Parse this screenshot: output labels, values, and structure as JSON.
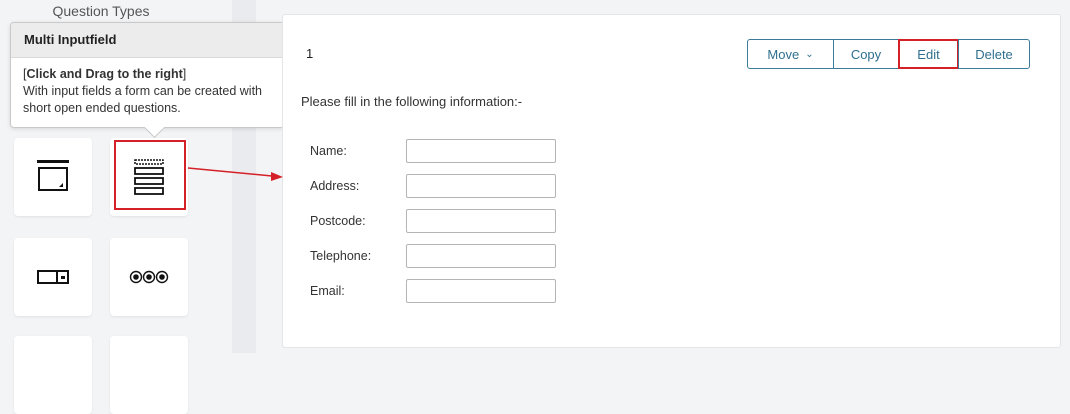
{
  "sidebar": {
    "title": "Question Types",
    "tiles": [
      {
        "icon": "single-input-icon"
      },
      {
        "icon": "multi-inputfield-icon"
      },
      {
        "icon": "dropdown-icon"
      },
      {
        "icon": "radio-buttons-icon"
      }
    ]
  },
  "tooltip": {
    "title": "Multi Inputfield",
    "bracket_open": "[",
    "action": "Click and Drag to the right",
    "bracket_close": "]",
    "description": "With input fields a form can be created with short open ended questions."
  },
  "question": {
    "number": "1",
    "instruction": "Please fill in the following information:-",
    "fields": [
      {
        "label": "Name:",
        "value": ""
      },
      {
        "label": "Address:",
        "value": ""
      },
      {
        "label": "Postcode:",
        "value": ""
      },
      {
        "label": "Telephone:",
        "value": ""
      },
      {
        "label": "Email:",
        "value": ""
      }
    ]
  },
  "toolbar": {
    "move_label": "Move",
    "copy_label": "Copy",
    "edit_label": "Edit",
    "delete_label": "Delete"
  },
  "colors": {
    "accent": "#2f6f8f",
    "highlight": "#d42027"
  }
}
